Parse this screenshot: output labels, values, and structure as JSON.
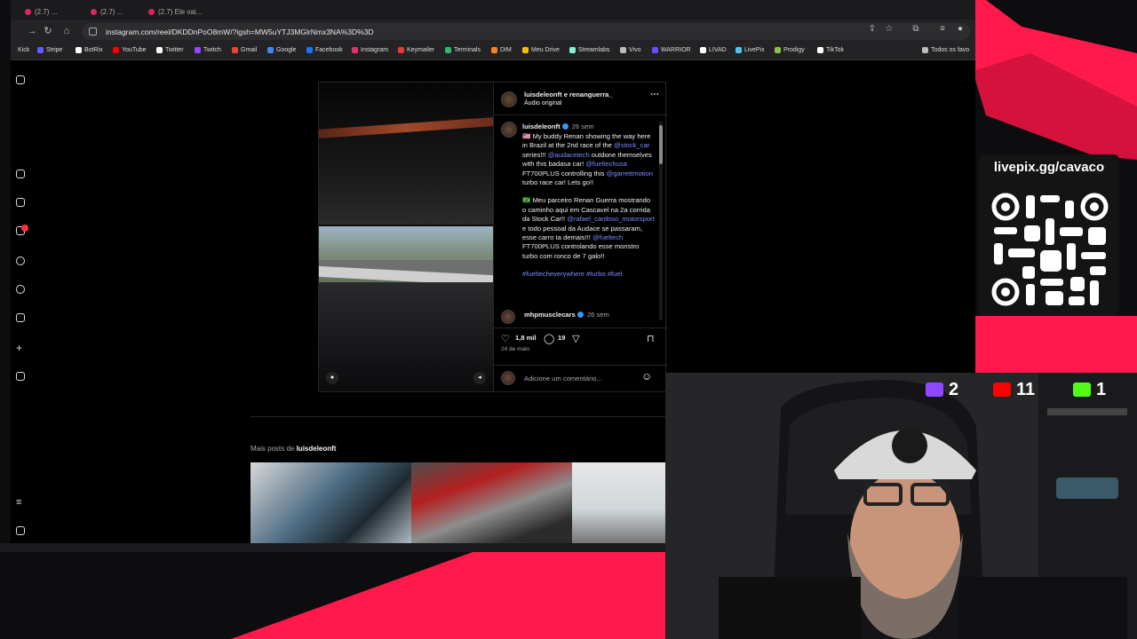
{
  "browser": {
    "tabs": [
      {
        "label": "(2.7) ..."
      },
      {
        "label": "(2.7) ..."
      },
      {
        "label": "(2.7) Ele vai..."
      }
    ],
    "url": "instagram.com/reel/DKDDnPoO8mW/?igsh=MW5uYTJ3MGlrNmx3NA%3D%3D",
    "bookmarks": [
      {
        "label": "Kick",
        "color": "#53fc18"
      },
      {
        "label": "Stripe",
        "color": "#635bff"
      },
      {
        "label": "BotRix",
        "color": "#ffffff"
      },
      {
        "label": "YouTube",
        "color": "#ff0000"
      },
      {
        "label": "Twitter",
        "color": "#ffffff"
      },
      {
        "label": "Twitch",
        "color": "#9146ff"
      },
      {
        "label": "Gmail",
        "color": "#ea4335"
      },
      {
        "label": "Google",
        "color": "#4285f4"
      },
      {
        "label": "Facebook",
        "color": "#1877f2"
      },
      {
        "label": "Instagram",
        "color": "#e1306c"
      },
      {
        "label": "Keymailer",
        "color": "#e53935"
      },
      {
        "label": "Terminals",
        "color": "#2eb872"
      },
      {
        "label": "DIM",
        "color": "#f58220"
      },
      {
        "label": "Meu Drive",
        "color": "#fbbc04"
      },
      {
        "label": "Streamlabs",
        "color": "#80f5d2"
      },
      {
        "label": "Vivo",
        "color": "#bbbbbb"
      },
      {
        "label": "WARRIOR",
        "color": "#6a4cff"
      },
      {
        "label": "LIVAD",
        "color": "#ffffff"
      },
      {
        "label": "LivePix",
        "color": "#4fc3f7"
      },
      {
        "label": "Prodigy",
        "color": "#8bc34a"
      },
      {
        "label": "TikTok",
        "color": "#ffffff"
      }
    ],
    "bookmarks_folder": "Todos os favo"
  },
  "post": {
    "header_user": "luisdeleonft e renanguerra_",
    "header_audio": "Áudio original",
    "author": "luisdeleonft",
    "author_time": "26 sem",
    "caption_en_parts": [
      "🇺🇸 My buddy Renan showing the way here in Brazil at the 2nd race of the ",
      "@stock_car",
      " series!!! ",
      "@audacetech",
      " outdone themselves with this badasa car! ",
      "@fueltechusa",
      " FT700PLUS controlling this ",
      "@garrettmotion",
      " turbo race car! Lets go!!"
    ],
    "caption_pt_parts": [
      "🇧🇷 Meu parceiro Renan Guerra mostrando o caminho aqui em Cascavel na 2a corrida da Stock Car!! ",
      "@rafael_cardoso_motorsport",
      " e todo pessoal da Audace se passaram, esse carro ta demais!!! ",
      "@fueltech",
      " FT700PLUS controlando esse monstro turbo com ronco de 7 galo!!"
    ],
    "hashtags": "#fueltecheverywhere #turbo #fuel",
    "comment_user": "mhpmusclecars",
    "comment_time": "26 sem",
    "likes": "1,8 mil",
    "comments": "19",
    "date": "24 de maio",
    "comment_placeholder": "Adicione um comentário..."
  },
  "more_posts": {
    "prefix": "Mais posts de ",
    "user": "luisdeleonft"
  },
  "stream": {
    "livepix_title": "livepix.gg/cavaco",
    "counters": [
      {
        "platform": "twitch",
        "value": "2",
        "color": "#9146ff"
      },
      {
        "platform": "youtube",
        "value": "11",
        "color": "#ff0000"
      },
      {
        "platform": "kick",
        "value": "1",
        "color": "#53fc18"
      }
    ],
    "accent_color": "#ff1a4b"
  }
}
